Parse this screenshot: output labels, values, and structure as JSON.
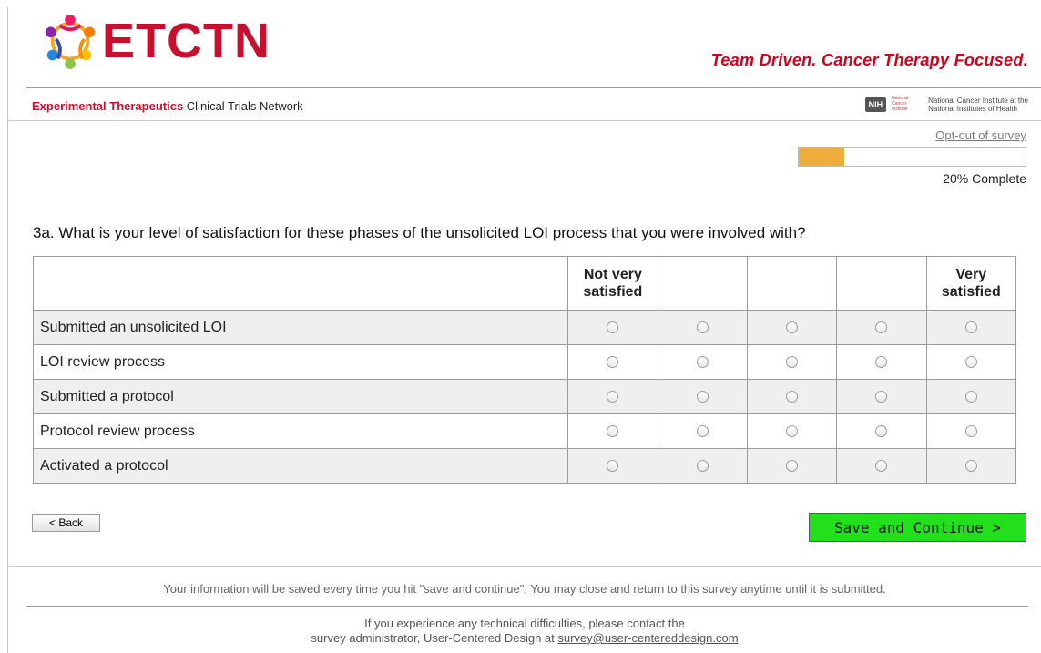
{
  "header": {
    "logo_text": "ETCTN",
    "tagline": "Team Driven. Cancer Therapy Focused.",
    "subtitle_red": "Experimental Therapeutics",
    "subtitle_rest": " Clinical Trials Network",
    "nih_badge": "NIH",
    "nih_seal_text": "National Cancer Institute",
    "nih_line1": "National Cancer Institute at the",
    "nih_line2": "National Institutes of Health"
  },
  "survey": {
    "optout_label": "Opt-out of survey",
    "progress_percent": 20,
    "progress_label": "20% Complete",
    "question": "3a. What is your level of satisfaction for these phases of the unsolicited LOI process that you were involved with?",
    "columns": [
      "Not very satisfied",
      "",
      "",
      "",
      "Very satisfied"
    ],
    "rows": [
      "Submitted an unsolicited LOI",
      "LOI review process",
      "Submitted a protocol",
      "Protocol review process",
      "Activated a protocol"
    ]
  },
  "buttons": {
    "back_label": "< Back",
    "save_label": "Save and Continue >"
  },
  "footer": {
    "note": "Your information will be saved every time you hit \"save and continue\". You may close and return to this survey anytime until it is submitted.",
    "contact_line1": "If you experience any technical difficulties, please contact the",
    "contact_line2": "survey administrator, User-Centered Design at ",
    "contact_email": "survey@user-centereddesign.com"
  },
  "colors": {
    "brand_red": "#c8102e",
    "progress_fill": "#f0ad3c",
    "save_button": "#23e01c"
  }
}
